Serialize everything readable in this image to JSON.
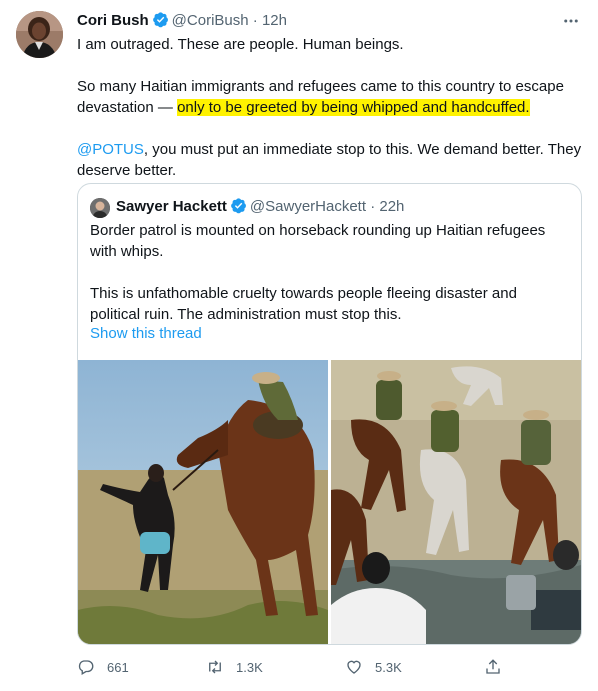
{
  "tweet": {
    "author_name": "Cori Bush",
    "author_handle": "@CoriBush",
    "separator": "·",
    "time": "12h",
    "line1": "I am outraged. These are people. Human beings.",
    "para2_a": "So many Haitian immigrants and refugees came to this country to escape devastation — ",
    "para2_highlight": "only to be greeted by being whipped and handcuffed.",
    "para3_mention": "@POTUS",
    "para3_rest": ", you must put an immediate stop to this. We demand better. They deserve better."
  },
  "quote": {
    "author_name": "Sawyer Hackett",
    "author_handle": "@SawyerHackett",
    "separator": "·",
    "time": "22h",
    "text1": "Border patrol is mounted on horseback rounding up Haitian refugees with whips.",
    "text2": "This is unfathomable cruelty towards people fleeing disaster and political ruin. The administration must stop this.",
    "show_thread": "Show this thread"
  },
  "actions": {
    "replies": "661",
    "retweets": "1.3K",
    "likes": "5.3K"
  },
  "colors": {
    "link": "#1d9bf0",
    "highlight": "#fff200",
    "muted": "#536471",
    "verified": "#1d9bf0"
  },
  "icons": [
    "verified-badge-icon",
    "more-icon",
    "reply-icon",
    "retweet-icon",
    "like-icon",
    "share-icon"
  ]
}
